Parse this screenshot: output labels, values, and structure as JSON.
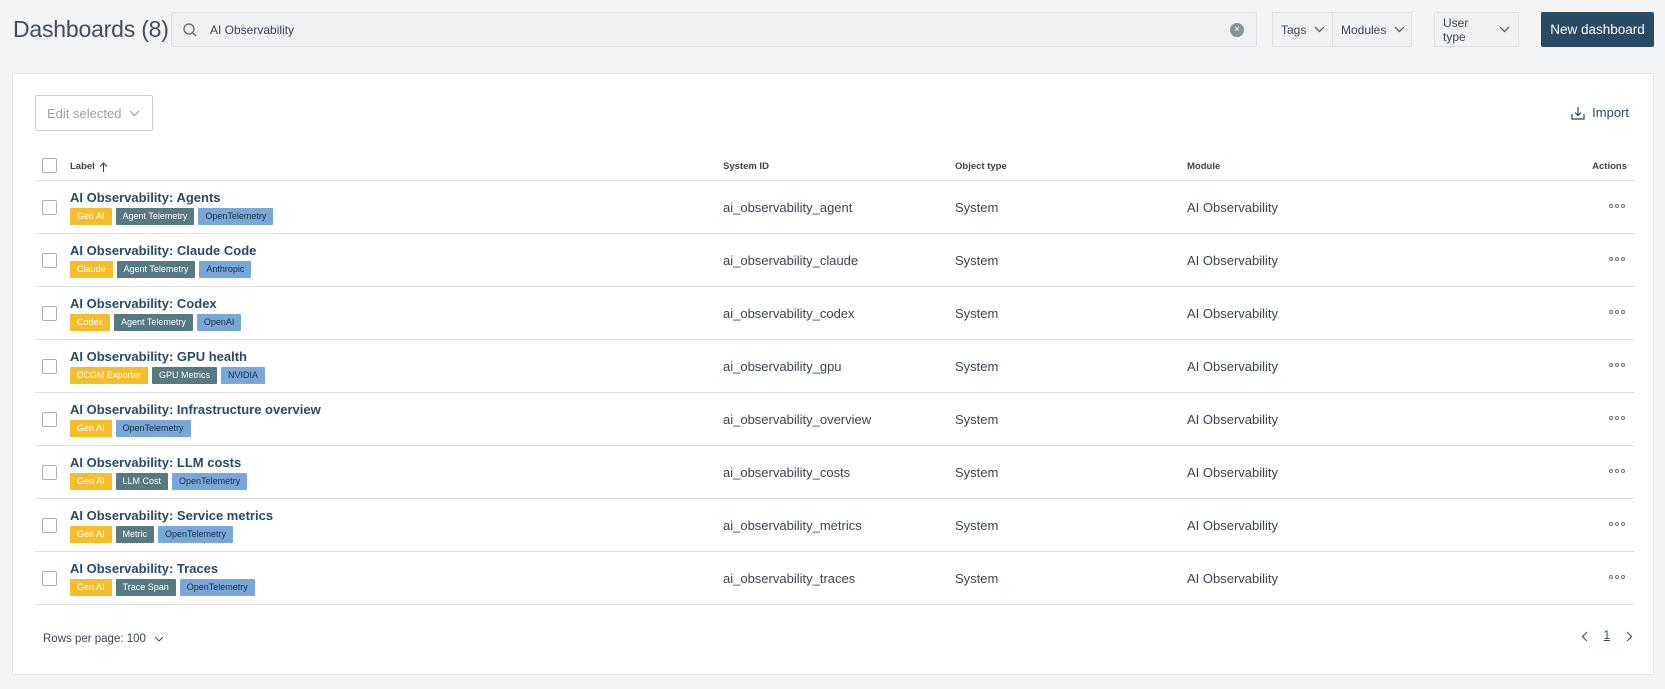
{
  "header": {
    "title": "Dashboards (8)",
    "search_value": "AI Observability",
    "filters": {
      "tags": "Tags",
      "modules": "Modules",
      "user_type": "User type"
    },
    "new_button": "New dashboard"
  },
  "toolbar": {
    "edit_selected": "Edit selected",
    "import": "Import"
  },
  "table": {
    "columns": {
      "label": "Label",
      "system_id": "System ID",
      "object_type": "Object type",
      "module": "Module",
      "actions": "Actions"
    },
    "rows": [
      {
        "label": "AI Observability: Agents",
        "tags": [
          {
            "text": "Gen AI",
            "color": "yellow"
          },
          {
            "text": "Agent Telemetry",
            "color": "teal"
          },
          {
            "text": "OpenTelemetry",
            "color": "blue"
          }
        ],
        "system_id": "ai_observability_agent",
        "object_type": "System",
        "module": "AI Observability"
      },
      {
        "label": "AI Observability: Claude Code",
        "tags": [
          {
            "text": "Claude",
            "color": "yellow"
          },
          {
            "text": "Agent Telemetry",
            "color": "teal"
          },
          {
            "text": "Anthropic",
            "color": "blue"
          }
        ],
        "system_id": "ai_observability_claude",
        "object_type": "System",
        "module": "AI Observability"
      },
      {
        "label": "AI Observability: Codex",
        "tags": [
          {
            "text": "Codex",
            "color": "yellow"
          },
          {
            "text": "Agent Telemetry",
            "color": "teal"
          },
          {
            "text": "OpenAI",
            "color": "blue"
          }
        ],
        "system_id": "ai_observability_codex",
        "object_type": "System",
        "module": "AI Observability"
      },
      {
        "label": "AI Observability: GPU health",
        "tags": [
          {
            "text": "DCGM Exporter",
            "color": "yellow"
          },
          {
            "text": "GPU Metrics",
            "color": "teal"
          },
          {
            "text": "NVIDIA",
            "color": "blue"
          }
        ],
        "system_id": "ai_observability_gpu",
        "object_type": "System",
        "module": "AI Observability"
      },
      {
        "label": "AI Observability: Infrastructure overview",
        "tags": [
          {
            "text": "Gen AI",
            "color": "yellow"
          },
          {
            "text": "OpenTelemetry",
            "color": "blue"
          }
        ],
        "system_id": "ai_observability_overview",
        "object_type": "System",
        "module": "AI Observability"
      },
      {
        "label": "AI Observability: LLM costs",
        "tags": [
          {
            "text": "Gen AI",
            "color": "yellow"
          },
          {
            "text": "LLM Cost",
            "color": "teal"
          },
          {
            "text": "OpenTelemetry",
            "color": "blue"
          }
        ],
        "system_id": "ai_observability_costs",
        "object_type": "System",
        "module": "AI Observability"
      },
      {
        "label": "AI Observability: Service metrics",
        "tags": [
          {
            "text": "Gen AI",
            "color": "yellow"
          },
          {
            "text": "Metric",
            "color": "teal"
          },
          {
            "text": "OpenTelemetry",
            "color": "blue"
          }
        ],
        "system_id": "ai_observability_metrics",
        "object_type": "System",
        "module": "AI Observability"
      },
      {
        "label": "AI Observability: Traces",
        "tags": [
          {
            "text": "Gen AI",
            "color": "yellow"
          },
          {
            "text": "Trace Span",
            "color": "teal"
          },
          {
            "text": "OpenTelemetry",
            "color": "blue"
          }
        ],
        "system_id": "ai_observability_traces",
        "object_type": "System",
        "module": "AI Observability"
      }
    ]
  },
  "footer": {
    "rows_per_page": "Rows per page: 100",
    "current_page": "1"
  },
  "colors": {
    "primary": "#284b63",
    "tag_yellow": "#f5bd2c",
    "tag_teal": "#577a82",
    "tag_blue": "#7aa7d9"
  }
}
